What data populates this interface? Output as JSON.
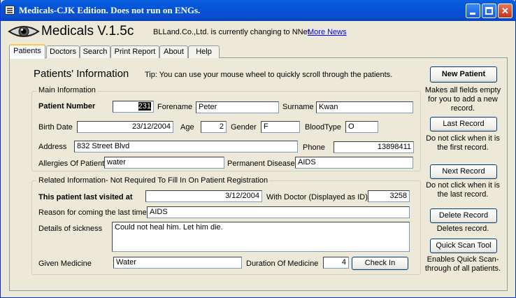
{
  "window": {
    "title": "Medicals-CJK Edition. Does not run on ENGs.",
    "minimize_glyph": "",
    "maximize_glyph": "",
    "close_glyph": "✕"
  },
  "brand": {
    "title": "Medicals V.1.5c",
    "message": "BLLand.Co.,Ltd. is currently changing to NNet.",
    "more_news": "More News",
    "logo_icon": "eye-icon"
  },
  "tabs": [
    {
      "label": "Patients",
      "active": true
    },
    {
      "label": "Doctors"
    },
    {
      "label": "Search"
    },
    {
      "label": "Print Report"
    },
    {
      "label": "About"
    },
    {
      "label": "Help"
    }
  ],
  "page": {
    "heading": "Patients' Information",
    "tip": "Tip: You can use your mouse wheel to quickly scroll through the patients."
  },
  "main_info": {
    "group_title": "Main Information",
    "patient_number_label": "Patient Number",
    "patient_number_prefix": "",
    "patient_number_selected": "231",
    "forename_label": "Forename",
    "forename": "Peter",
    "surname_label": "Surname",
    "surname": "Kwan",
    "birth_date_label": "Birth Date",
    "birth_date": "23/12/2004",
    "age_label": "Age",
    "age": "2",
    "gender_label": "Gender",
    "gender": "F",
    "bloodtype_label": "BloodType",
    "bloodtype": "O",
    "address_label": "Address",
    "address": "832 Street Blvd",
    "phone_label": "Phone",
    "phone": "13898411",
    "allergies_label": "Allergies Of Patient",
    "allergies": "water",
    "permanent_disease_label": "Permanent Disease",
    "permanent_disease": "AIDS"
  },
  "related_info": {
    "group_title": "Related Information- Not Required To Fill In On Patient Registration",
    "last_visited_label": "This patient last visited at",
    "last_visited": "3/12/2004",
    "doctor_label": "With Doctor (Displayed as ID)",
    "doctor_id": "3258",
    "reason_label": "Reason for coming the last time",
    "reason": "AIDS",
    "details_label": "Details of sickness",
    "details": "Could not heal him. Let him die.",
    "medicine_label": "Given Medicine",
    "medicine": "Water",
    "duration_label": "Duration Of Medicine",
    "duration": "4",
    "check_in": "Check In"
  },
  "actions": {
    "new_patient": "New Patient",
    "new_patient_desc": "Makes all fields empty for you to add a new record.",
    "last_record": "Last Record",
    "last_record_desc": "Do not click when it is the first record.",
    "next_record": "Next Record",
    "next_record_desc": "Do not click when it is the last record.",
    "delete_record": "Delete Record",
    "delete_record_desc": "Deletes record.",
    "quick_scan": "Quick Scan Tool",
    "quick_scan_desc": "Enables Quick Scan-through of all patients."
  }
}
